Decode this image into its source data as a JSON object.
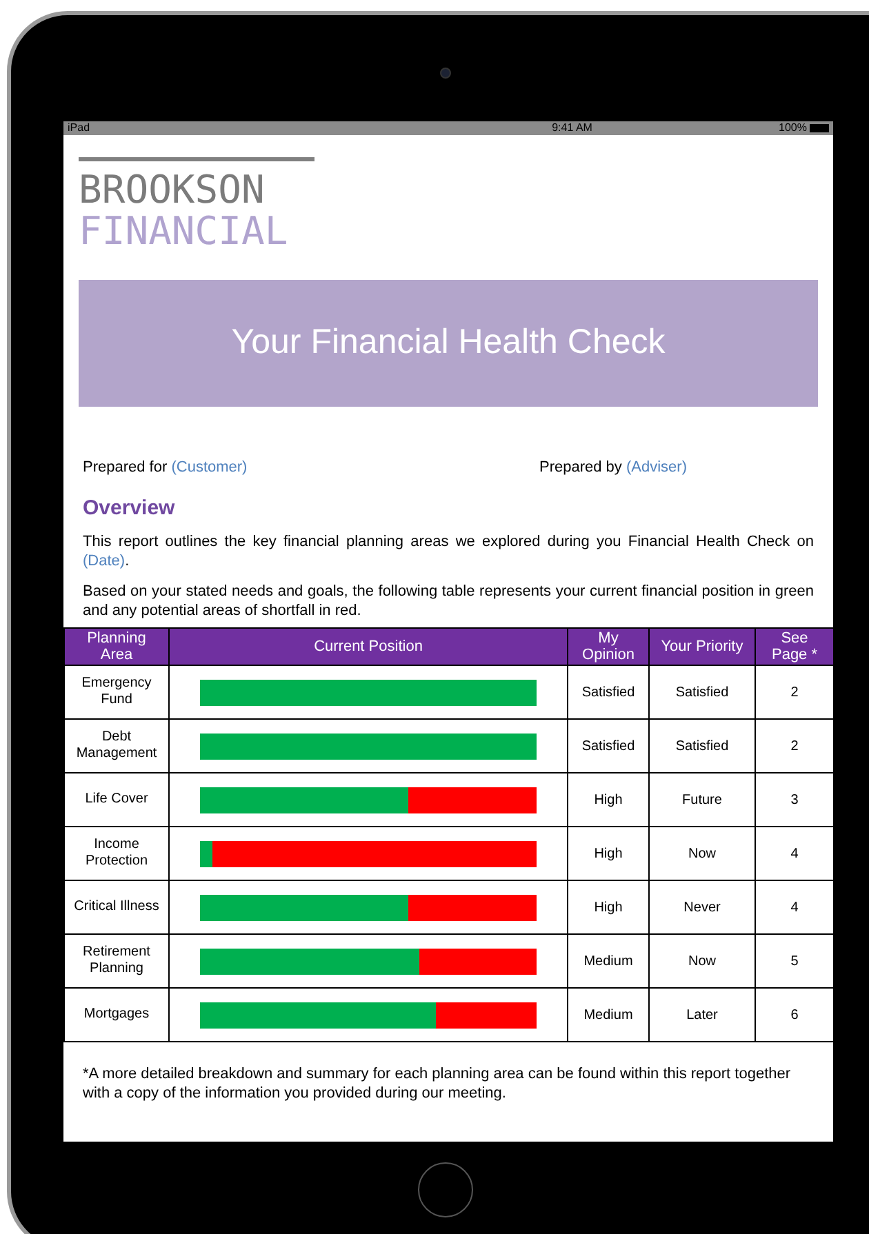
{
  "status_bar": {
    "device": "iPad",
    "time": "9:41 AM",
    "battery": "100%"
  },
  "logo": {
    "line1": "BROOKSON",
    "line2": "FINANCIAL"
  },
  "banner": {
    "title": "Your Financial Health Check"
  },
  "prepared_for": {
    "label": "Prepared for",
    "value": "(Customer)"
  },
  "prepared_by": {
    "label": "Prepared by",
    "value": "(Adviser)"
  },
  "section_title": "Overview",
  "intro": {
    "text": "This report outlines the key financial planning areas we explored during you Financial Health Check on",
    "date": "(Date)",
    "end": "."
  },
  "description": "Based on your stated needs and goals, the following table represents your current financial position in green and any potential areas of shortfall in red.",
  "table": {
    "columns": [
      "Planning Area",
      "Current Position",
      "My Opinion",
      "Your Priority",
      "See Page *"
    ],
    "rows": [
      {
        "area": "Emergency Fund",
        "level": 1,
        "opinion": "Satisfied",
        "priority": "Satisfied",
        "page": "2"
      },
      {
        "area": "Debt Management",
        "level": 1,
        "opinion": "Satisfied",
        "priority": "Satisfied",
        "page": "2"
      },
      {
        "area": "Life Cover",
        "level": 0.62,
        "opinion": "High",
        "priority": "Future",
        "page": "3"
      },
      {
        "area": "Income Protection",
        "level": 0.035,
        "opinion": "High",
        "priority": "Now",
        "page": "4"
      },
      {
        "area": "Critical Illness",
        "level": 0.62,
        "opinion": "High",
        "priority": "Never",
        "page": "4"
      },
      {
        "area": "Retirement Planning",
        "level": 0.65,
        "opinion": "Medium",
        "priority": "Now",
        "page": "5"
      },
      {
        "area": "Mortgages",
        "level": 0.7,
        "opinion": "Medium",
        "priority": "Later",
        "page": "6"
      }
    ]
  },
  "footnote": "*A more detailed breakdown and summary for each planning area can be found within this report together with a copy of the information you provided during our meeting."
}
